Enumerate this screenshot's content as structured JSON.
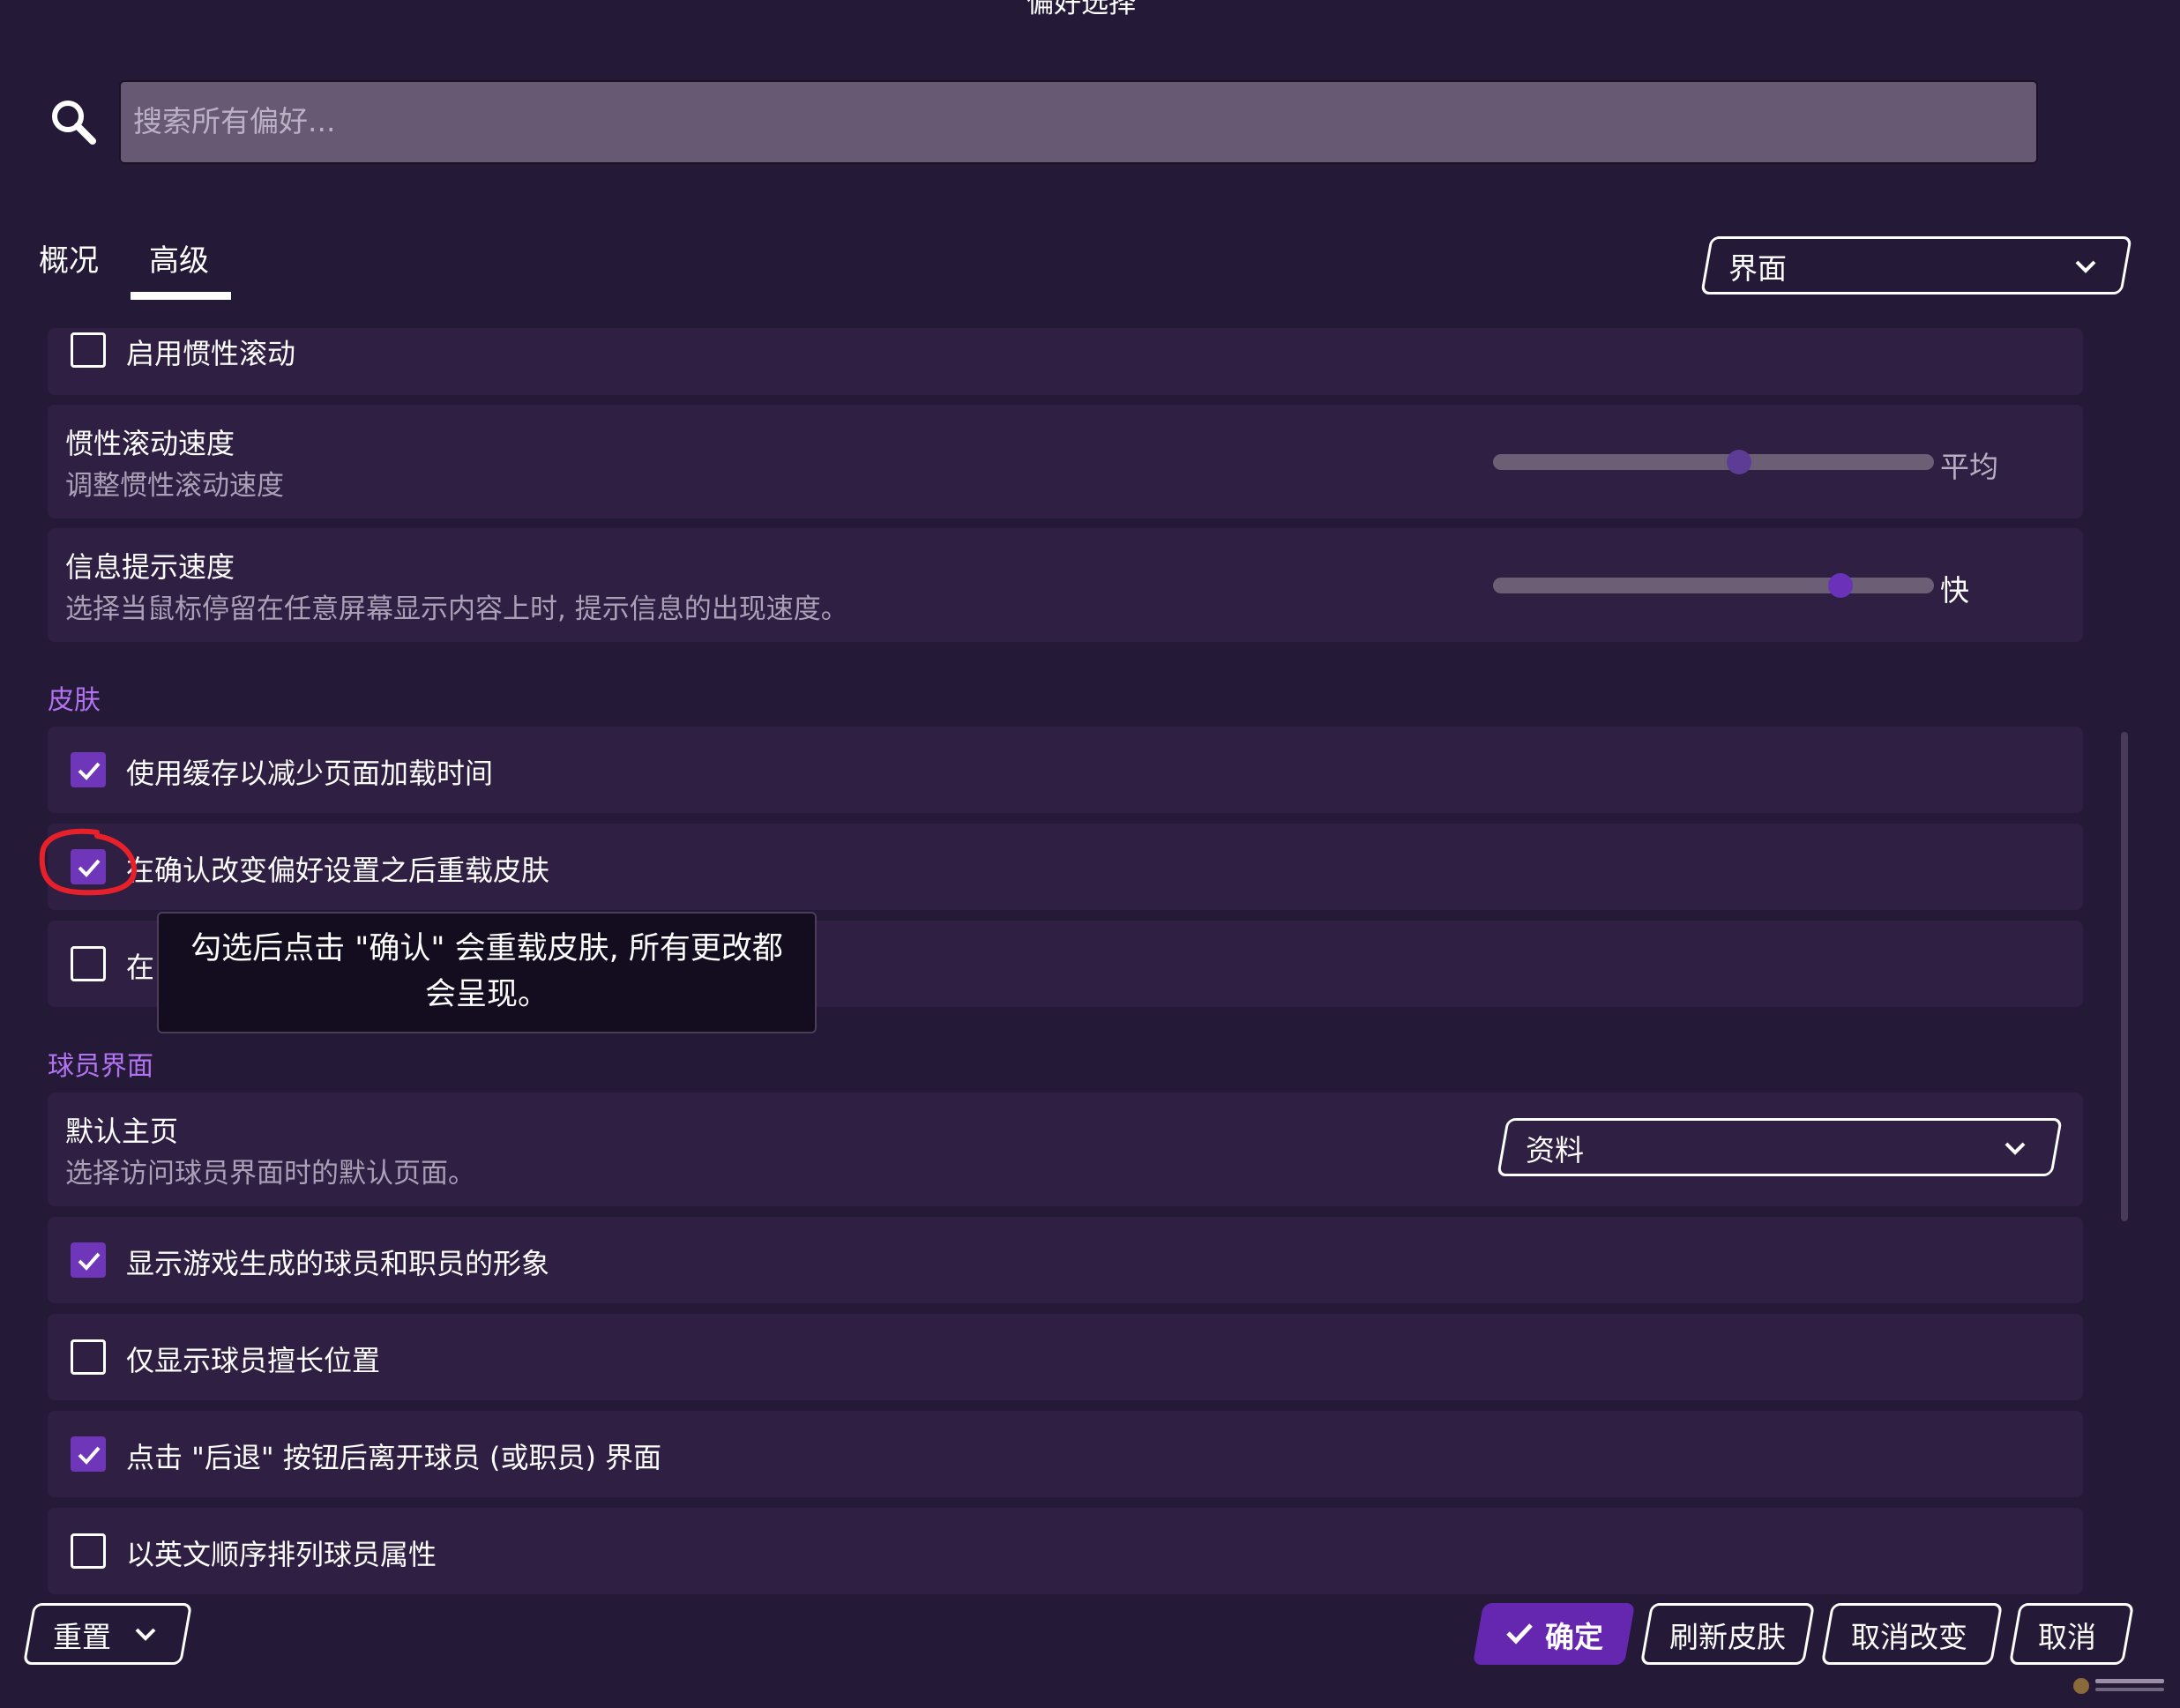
{
  "dialog": {
    "title": "偏好选择"
  },
  "search": {
    "placeholder": "搜索所有偏好..."
  },
  "tabs": [
    {
      "label": "概况",
      "active": false
    },
    {
      "label": "高级",
      "active": true
    }
  ],
  "category_select": {
    "value": "界面"
  },
  "rows": {
    "inertia_scroll": {
      "label": "启用惯性滚动",
      "checked": false
    },
    "inertia_speed": {
      "label": "惯性滚动速度",
      "desc": "调整惯性滚动速度",
      "value_label": "平均",
      "slider_level": 0.55
    },
    "tooltip_speed": {
      "label": "信息提示速度",
      "desc": "选择当鼠标停留在任意屏幕显示内容上时, 提示信息的出现速度。",
      "value_label": "快",
      "slider_level": 0.78
    }
  },
  "sections": {
    "skin": "皮肤",
    "player": "球员界面"
  },
  "skin_rows": [
    {
      "label": "使用缓存以减少页面加载时间",
      "checked": true
    },
    {
      "label": "在确认改变偏好设置之后重载皮肤",
      "checked": true
    },
    {
      "label": "在",
      "checked": false
    }
  ],
  "tooltip": {
    "line1": "勾选后点击 \"确认\" 会重载皮肤, 所有更改都",
    "line2": "会呈现。"
  },
  "player_rows": {
    "default_home": {
      "label": "默认主页",
      "desc": "选择访问球员界面时的默认页面。",
      "select_value": "资料"
    },
    "checks": [
      {
        "label": "显示游戏生成的球员和职员的形象",
        "checked": true
      },
      {
        "label": "仅显示球员擅长位置",
        "checked": false
      },
      {
        "label": "点击 \"后退\" 按钮后离开球员 (或职员) 界面",
        "checked": true
      },
      {
        "label": "以英文顺序排列球员属性",
        "checked": false
      }
    ]
  },
  "footer": {
    "reset": "重置",
    "confirm": "确定",
    "refresh_skin": "刷新皮肤",
    "cancel_changes": "取消改变",
    "cancel": "取消"
  },
  "colors": {
    "background": "#241a37",
    "row": "#2e1f43",
    "accent": "#6f36b9",
    "section": "#b273f0",
    "annotation": "#e8202a"
  },
  "icons": [
    "search-icon",
    "chevron-down-icon",
    "checkmark-icon"
  ]
}
